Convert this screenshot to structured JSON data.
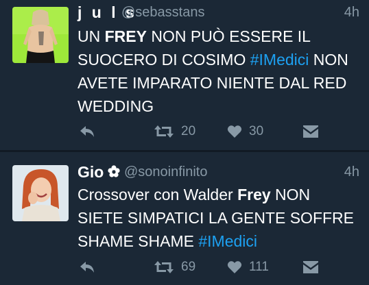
{
  "colors": {
    "background": "#1b2836",
    "divider": "#111a24",
    "text": "#ffffff",
    "muted": "#8899a6",
    "hashtag": "#1da1f2"
  },
  "tweets": [
    {
      "display_name": "j u l s",
      "handle": "@sebasstans",
      "time": "4h",
      "avatar_icon": "person-green-background",
      "text": {
        "part1": "UN ",
        "bold1": "FREY",
        "part2": " NON PUÒ ESSERE IL SUOCERO DI COSIMO ",
        "hashtag": "#IMedici",
        "part3": " NON AVETE IMPARATO NIENTE DAL RED WEDDING"
      },
      "retweets": "20",
      "likes": "30"
    },
    {
      "display_name": "Gio",
      "name_icon": "flower-icon",
      "handle": "@sonoinfinito",
      "time": "4h",
      "avatar_icon": "laughing-redhead-woman",
      "text": {
        "part1": "Crossover con Walder ",
        "bold1": "Frey",
        "part2": " NON SIETE SIMPATICI LA GENTE SOFFRE SHAME SHAME ",
        "hashtag": "#IMedici",
        "part3": ""
      },
      "retweets": "69",
      "likes": "111"
    }
  ]
}
